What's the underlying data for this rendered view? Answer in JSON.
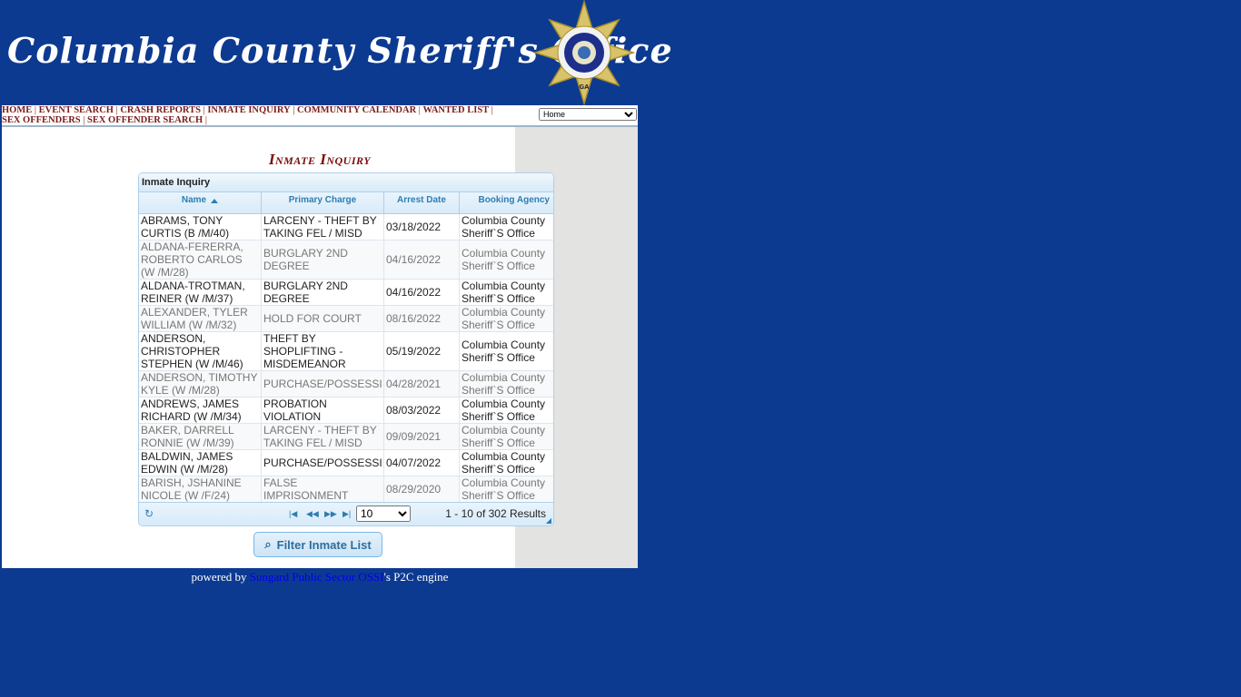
{
  "header": {
    "title": "Columbia County Sheriff's Office",
    "badge": {
      "top_text": "SHERIFF'S OFFICE",
      "bottom_text": "COLUMBIA COUNTY",
      "state": "GA"
    }
  },
  "nav": {
    "links": [
      "HOME",
      "EVENT SEARCH",
      "CRASH REPORTS",
      "INMATE INQUIRY",
      "COMMUNITY CALENDAR",
      "WANTED LIST",
      "SEX OFFENDERS",
      "SEX OFFENDER SEARCH"
    ],
    "select_value": "Home"
  },
  "page_title": "Inmate Inquiry",
  "grid": {
    "caption": "Inmate Inquiry",
    "columns": [
      "Name",
      "Primary Charge",
      "Arrest Date",
      "Booking Agency"
    ],
    "rows": [
      {
        "name": "ABRAMS, TONY CURTIS (B /M/40)",
        "charge": "LARCENY - THEFT BY TAKING FEL / MISD",
        "date": "03/18/2022",
        "agency": "Columbia County Sheriff`S Office"
      },
      {
        "name": "ALDANA-FERERRA, ROBERTO CARLOS (W /M/28)",
        "charge": "BURGLARY 2ND DEGREE",
        "date": "04/16/2022",
        "agency": "Columbia County Sheriff`S Office"
      },
      {
        "name": "ALDANA-TROTMAN, REINER (W /M/37)",
        "charge": "BURGLARY 2ND DEGREE",
        "date": "04/16/2022",
        "agency": "Columbia County Sheriff`S Office"
      },
      {
        "name": "ALEXANDER, TYLER WILLIAM (W /M/32)",
        "charge": "HOLD FOR COURT",
        "date": "08/16/2022",
        "agency": "Columbia County Sheriff`S Office"
      },
      {
        "name": "ANDERSON, CHRISTOPHER STEPHEN (W /M/46)",
        "charge": "THEFT BY SHOPLIFTING - MISDEMEANOR",
        "date": "05/19/2022",
        "agency": "Columbia County Sheriff`S Office"
      },
      {
        "name": "ANDERSON, TIMOTHY KYLE (W /M/28)",
        "charge": "PURCHASE/POSSESSI",
        "date": "04/28/2021",
        "agency": "Columbia County Sheriff`S Office"
      },
      {
        "name": "ANDREWS, JAMES RICHARD (W /M/34)",
        "charge": "PROBATION VIOLATION",
        "date": "08/03/2022",
        "agency": "Columbia County Sheriff`S Office"
      },
      {
        "name": "BAKER, DARRELL RONNIE (W /M/39)",
        "charge": "LARCENY - THEFT BY TAKING FEL / MISD",
        "date": "09/09/2021",
        "agency": "Columbia County Sheriff`S Office"
      },
      {
        "name": "BALDWIN, JAMES EDWIN (W /M/28)",
        "charge": "PURCHASE/POSSESSI",
        "date": "04/07/2022",
        "agency": "Columbia County Sheriff`S Office"
      },
      {
        "name": "BARISH, JSHANINE NICOLE (W /F/24)",
        "charge": "FALSE IMPRISONMENT",
        "date": "08/29/2020",
        "agency": "Columbia County Sheriff`S Office"
      }
    ],
    "page_size": "10",
    "results_text": "1 - 10 of 302 Results"
  },
  "filter_button": "Filter Inmate List",
  "footer": {
    "prefix": "powered by ",
    "link_text": "Sungard Public Sector OSSI",
    "suffix": "'s P2C engine"
  }
}
